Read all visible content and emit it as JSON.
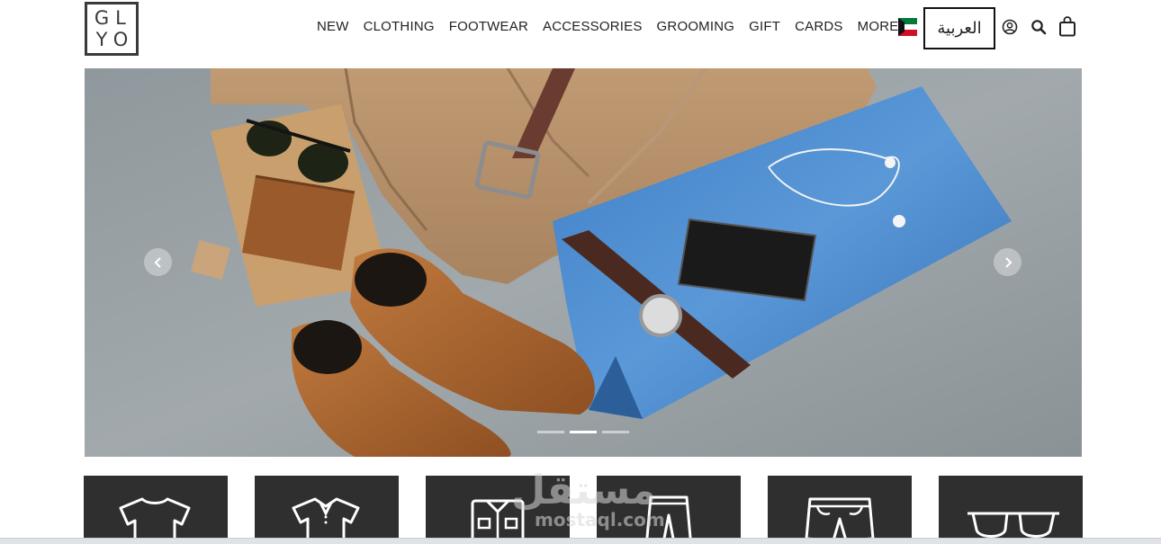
{
  "brand": {
    "logo_letters": [
      "G",
      "L",
      "Y",
      "O"
    ]
  },
  "nav": {
    "items": [
      "NEW",
      "CLOTHING",
      "FOOTWEAR",
      "ACCESSORIES",
      "GROOMING",
      "GIFT",
      "CARDS"
    ],
    "more_label": "MORE"
  },
  "header": {
    "language_button": "العربية",
    "flag": "kuwait-flag",
    "icons": [
      "user-account-icon",
      "search-icon",
      "shopping-bag-icon"
    ]
  },
  "carousel": {
    "slide_count": 3,
    "active_index": 1,
    "prev_icon": "chevron-left-icon",
    "next_icon": "chevron-right-icon"
  },
  "categories": {
    "icons": [
      "tshirt-icon",
      "polo-shirt-icon",
      "button-shirt-icon",
      "trousers-icon",
      "shorts-icon",
      "glasses-icon"
    ]
  },
  "watermark": {
    "arabic": "مستقل",
    "latin": "mostaql.com"
  },
  "colors": {
    "tile_bg": "#2f2f2f",
    "text": "#222222",
    "accent_border": "#111111"
  }
}
